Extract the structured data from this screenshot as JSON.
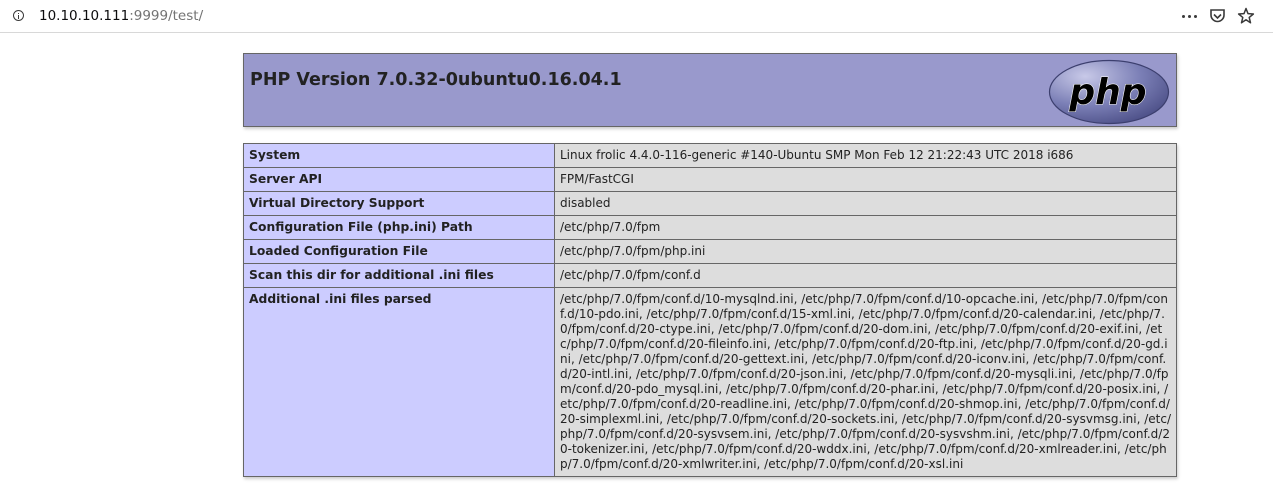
{
  "browser": {
    "url_host": "10.10.10.111",
    "url_rest": ":9999/test/",
    "icons": [
      "info-icon",
      "more-icon",
      "pocket-icon",
      "star-icon"
    ]
  },
  "header": {
    "title": "PHP Version 7.0.32-0ubuntu0.16.04.1",
    "logo_text": "php"
  },
  "rows": [
    {
      "label": "System",
      "value": "Linux frolic 4.4.0-116-generic #140-Ubuntu SMP Mon Feb 12 21:22:43 UTC 2018 i686"
    },
    {
      "label": "Server API",
      "value": "FPM/FastCGI"
    },
    {
      "label": "Virtual Directory Support",
      "value": "disabled"
    },
    {
      "label": "Configuration File (php.ini) Path",
      "value": "/etc/php/7.0/fpm"
    },
    {
      "label": "Loaded Configuration File",
      "value": "/etc/php/7.0/fpm/php.ini"
    },
    {
      "label": "Scan this dir for additional .ini files",
      "value": "/etc/php/7.0/fpm/conf.d"
    },
    {
      "label": "Additional .ini files parsed",
      "value": "/etc/php/7.0/fpm/conf.d/10-mysqlnd.ini, /etc/php/7.0/fpm/conf.d/10-opcache.ini, /etc/php/7.0/fpm/conf.d/10-pdo.ini, /etc/php/7.0/fpm/conf.d/15-xml.ini, /etc/php/7.0/fpm/conf.d/20-calendar.ini, /etc/php/7.0/fpm/conf.d/20-ctype.ini, /etc/php/7.0/fpm/conf.d/20-dom.ini, /etc/php/7.0/fpm/conf.d/20-exif.ini, /etc/php/7.0/fpm/conf.d/20-fileinfo.ini, /etc/php/7.0/fpm/conf.d/20-ftp.ini, /etc/php/7.0/fpm/conf.d/20-gd.ini, /etc/php/7.0/fpm/conf.d/20-gettext.ini, /etc/php/7.0/fpm/conf.d/20-iconv.ini, /etc/php/7.0/fpm/conf.d/20-intl.ini, /etc/php/7.0/fpm/conf.d/20-json.ini, /etc/php/7.0/fpm/conf.d/20-mysqli.ini, /etc/php/7.0/fpm/conf.d/20-pdo_mysql.ini, /etc/php/7.0/fpm/conf.d/20-phar.ini, /etc/php/7.0/fpm/conf.d/20-posix.ini, /etc/php/7.0/fpm/conf.d/20-readline.ini, /etc/php/7.0/fpm/conf.d/20-shmop.ini, /etc/php/7.0/fpm/conf.d/20-simplexml.ini, /etc/php/7.0/fpm/conf.d/20-sockets.ini, /etc/php/7.0/fpm/conf.d/20-sysvmsg.ini, /etc/php/7.0/fpm/conf.d/20-sysvsem.ini, /etc/php/7.0/fpm/conf.d/20-sysvshm.ini, /etc/php/7.0/fpm/conf.d/20-tokenizer.ini, /etc/php/7.0/fpm/conf.d/20-wddx.ini, /etc/php/7.0/fpm/conf.d/20-xmlreader.ini, /etc/php/7.0/fpm/conf.d/20-xmlwriter.ini, /etc/php/7.0/fpm/conf.d/20-xsl.ini"
    }
  ]
}
